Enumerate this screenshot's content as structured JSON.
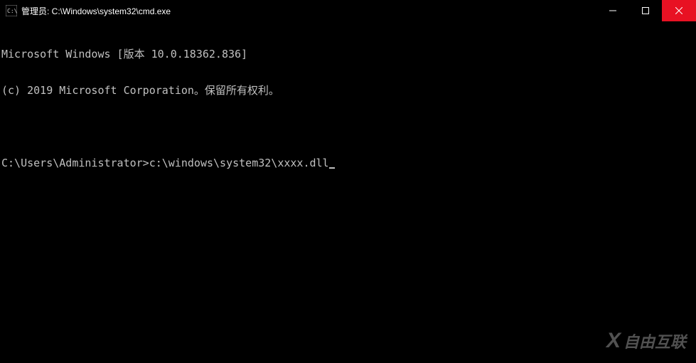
{
  "titlebar": {
    "text": "管理员: C:\\Windows\\system32\\cmd.exe"
  },
  "terminal": {
    "line1": "Microsoft Windows [版本 10.0.18362.836]",
    "line2": "(c) 2019 Microsoft Corporation。保留所有权利。",
    "prompt": "C:\\Users\\Administrator>",
    "command": "c:\\windows\\system32\\xxxx.dll"
  },
  "watermark": {
    "x": "X",
    "text": "自由互联"
  }
}
